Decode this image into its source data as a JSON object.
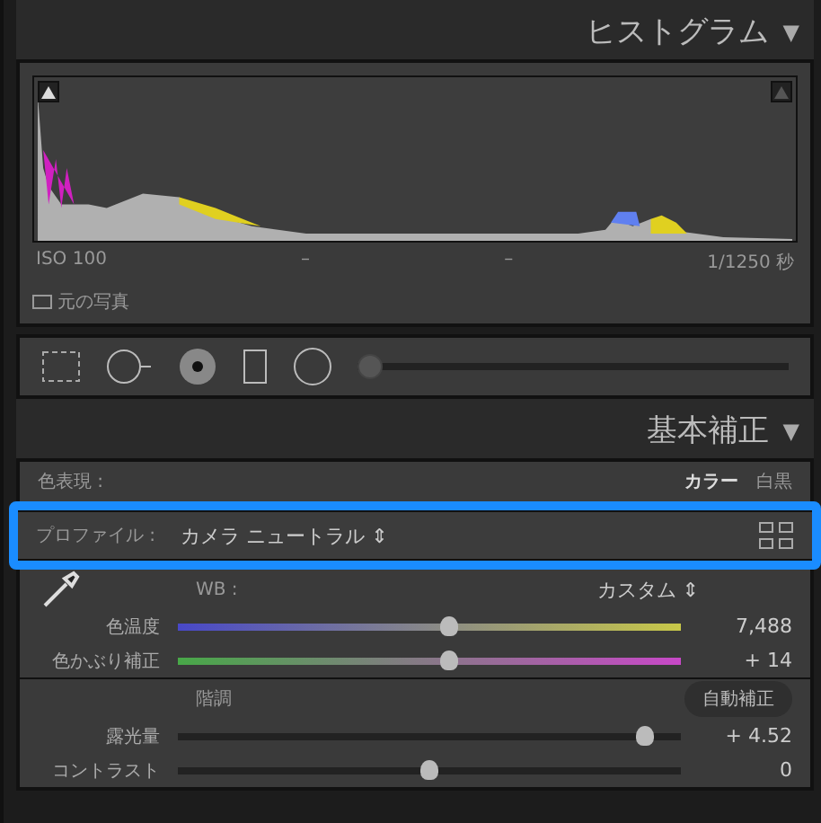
{
  "histogram_panel": {
    "title": "ヒストグラム",
    "collapse_glyph": "▼",
    "iso": "ISO 100",
    "aperture": "–",
    "focal": "–",
    "shutter": "1/1250 秒",
    "show_original": {
      "label": "元の写真",
      "checked": false
    }
  },
  "tool_strip": {
    "level": 0.0
  },
  "basic_panel": {
    "title": "基本補正",
    "collapse_glyph": "▼",
    "treatment": {
      "label": "色表現 :",
      "options": [
        {
          "label": "カラー",
          "selected": true
        },
        {
          "label": "白黒",
          "selected": false
        }
      ]
    },
    "profile": {
      "label": "プロファイル :",
      "value": "カメラ ニュートラル",
      "spinner": "⇕",
      "highlighted": true
    },
    "wb": {
      "label": "WB :",
      "value": "カスタム",
      "spinner": "⇕"
    },
    "wb_sliders": [
      {
        "label": "色温度",
        "reading": "7,488",
        "level": 0.54,
        "kind": "temp"
      },
      {
        "label": "色かぶり補正",
        "reading": "+ 14",
        "level": 0.54,
        "kind": "tint"
      }
    ],
    "tone": {
      "label": "階調",
      "auto_button": "自動補正"
    },
    "tone_sliders": [
      {
        "label": "露光量",
        "reading": "+ 4.52",
        "level": 0.93
      },
      {
        "label": "コントラスト",
        "reading": "0",
        "level": 0.5
      }
    ]
  }
}
